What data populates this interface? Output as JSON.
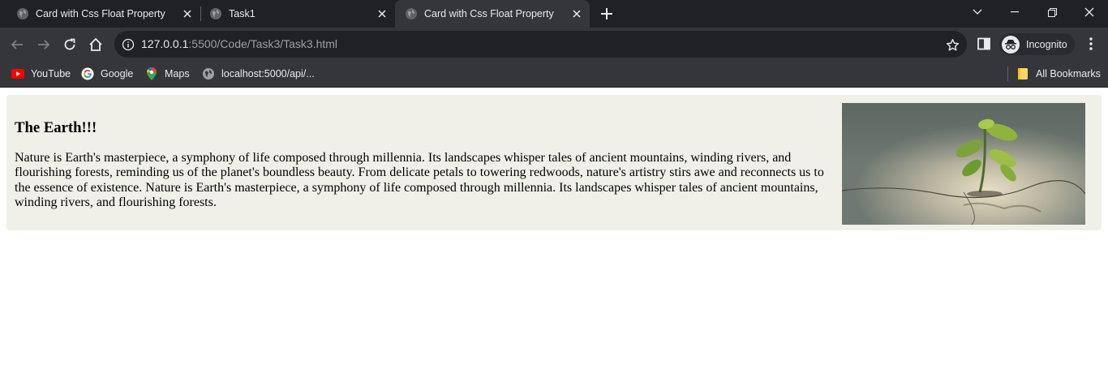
{
  "browser": {
    "tabs": [
      {
        "title": "Card with Css Float Property",
        "active": false
      },
      {
        "title": "Task1",
        "active": false
      },
      {
        "title": "Card with Css Float Property",
        "active": true
      }
    ],
    "address": {
      "host": "127.0.0.1",
      "path": ":5500/Code/Task3/Task3.html"
    },
    "profile_label": "Incognito",
    "bookmarks": [
      {
        "label": "YouTube",
        "icon": "youtube-icon"
      },
      {
        "label": "Google",
        "icon": "google-icon"
      },
      {
        "label": "Maps",
        "icon": "maps-icon"
      },
      {
        "label": "localhost:5000/api/...",
        "icon": "globe-icon"
      }
    ],
    "all_bookmarks_label": "All Bookmarks"
  },
  "card": {
    "title": "The Earth!!!",
    "text": "Nature is Earth's masterpiece, a symphony of life composed through millennia. Its landscapes whisper tales of ancient mountains, winding rivers, and flourishing forests, reminding us of the planet's boundless beauty. From delicate petals to towering redwoods, nature's artistry stirs awe and reconnects us to the essence of existence. Nature is Earth's masterpiece, a symphony of life composed through millennia. Its landscapes whisper tales of ancient mountains, winding rivers, and flourishing forests.",
    "image_icon": "sprout-image"
  },
  "colors": {
    "tab_bar": "#202124",
    "toolbar": "#35363a",
    "card_background": "#f0f0e9"
  }
}
